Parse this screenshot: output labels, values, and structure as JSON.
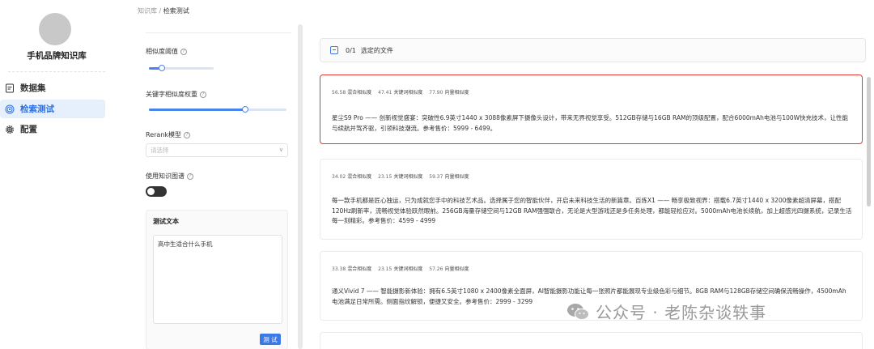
{
  "nav": {
    "kb_name": "手机品牌知识库",
    "items": [
      {
        "label": "数据集",
        "icon": "file-icon"
      },
      {
        "label": "检索测试",
        "icon": "target-icon"
      },
      {
        "label": "配置",
        "icon": "gear-icon"
      }
    ],
    "active_index": 1
  },
  "breadcrumb": {
    "root": "知识库",
    "sep": "/",
    "current": "检索测试"
  },
  "settings": {
    "similarity_threshold_label": "相似度阈值",
    "similarity_threshold_value": 0.2,
    "keyword_weight_label": "关键字相似度权重",
    "keyword_weight_value": 0.7,
    "rerank_label": "Rerank模型",
    "rerank_placeholder": "请选择",
    "knowledge_graph_label": "使用知识图谱",
    "knowledge_graph_on": false,
    "test_text_title": "测试文本",
    "test_text_value": "高中生适合什么手机",
    "test_button": "测 试"
  },
  "results": {
    "selection_count": "0/1",
    "selection_label": "选定的文件",
    "score_labels": {
      "hybrid": "混合相似度",
      "keyword": "关键词相似度",
      "vector": "向量相似度"
    },
    "items": [
      {
        "hybrid": "56.58",
        "keyword": "47.41",
        "vector": "77.90",
        "text": "星尘S9 Pro —— 创新视觉盛宴：突破性6.9英寸1440 x 3088像素屏下摄像头设计，带来无界视觉享受。512GB存储与16GB RAM的顶级配置，配合6000mAh电池与100W快充技术，让性能与续航并驾齐驱，引领科技潮流。参考售价：5999 - 6499。"
      },
      {
        "hybrid": "34.02",
        "keyword": "23.15",
        "vector": "59.37",
        "text": "每一款手机都是匠心独运，只为成就您手中的科技艺术品。选择属于您的智能伙伴，开启未来科技生活的新篇章。百炼X1 —— 畅享极致视界：搭载6.7英寸1440 x 3200像素超清屏幕，搭配120Hz刷新率，流畅视觉体验跃然眼前。256GB海量存储空间与12GB RAM强强联合，无论是大型游戏还是多任务处理，都能轻松应对。5000mAh电池长续航，加上超感光四摄系统，记录生活每一刻精彩。参考售价：4599 - 4999"
      },
      {
        "hybrid": "33.38",
        "keyword": "23.15",
        "vector": "57.26",
        "text": "通义Vivid 7 —— 智能摄影新体验：拥有6.5英寸1080 x 2400像素全面屏，AI智能摄影功能让每一张照片都能展现专业级色彩与细节。8GB RAM与128GB存储空间确保流畅操作，4500mAh电池满足日常所需。侧面指纹解锁，便捷又安全。参考售价：2999 - 3299"
      }
    ]
  },
  "watermark": "公众号 · 老陈杂谈轶事"
}
